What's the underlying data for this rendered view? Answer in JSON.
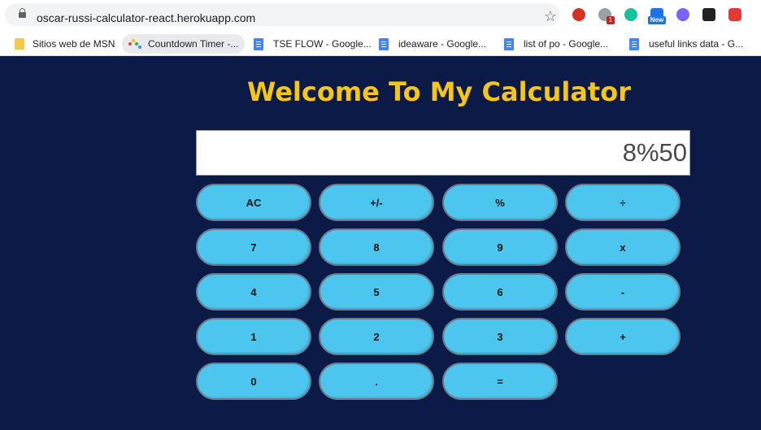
{
  "browser": {
    "url": "oscar-russi-calculator-react.herokuapp.com",
    "extension_badge": "1",
    "extension_new_label": "New",
    "bookmarks": [
      {
        "label": "Sitios web de MSN",
        "icon": "folder-icon"
      },
      {
        "label": "Countdown Timer -...",
        "icon": "colorful-dots-icon"
      },
      {
        "label": "TSE FLOW - Google...",
        "icon": "google-docs-icon"
      },
      {
        "label": "ideaware - Google...",
        "icon": "google-docs-icon"
      },
      {
        "label": "list of po - Google...",
        "icon": "google-docs-icon"
      },
      {
        "label": "useful links data - G...",
        "icon": "google-docs-icon"
      }
    ]
  },
  "calculator": {
    "title": "Welcome To My Calculator",
    "display_value": "8%50",
    "keys": [
      [
        "AC",
        "+/-",
        "%",
        "÷"
      ],
      [
        "7",
        "8",
        "9",
        "x"
      ],
      [
        "4",
        "5",
        "6",
        "-"
      ],
      [
        "1",
        "2",
        "3",
        "+"
      ],
      [
        "0",
        ".",
        "="
      ]
    ]
  },
  "colors": {
    "background": "#0b1a47",
    "title": "#f5c518",
    "key": "#4cc6ef",
    "key_border": "#6b7a8a"
  }
}
